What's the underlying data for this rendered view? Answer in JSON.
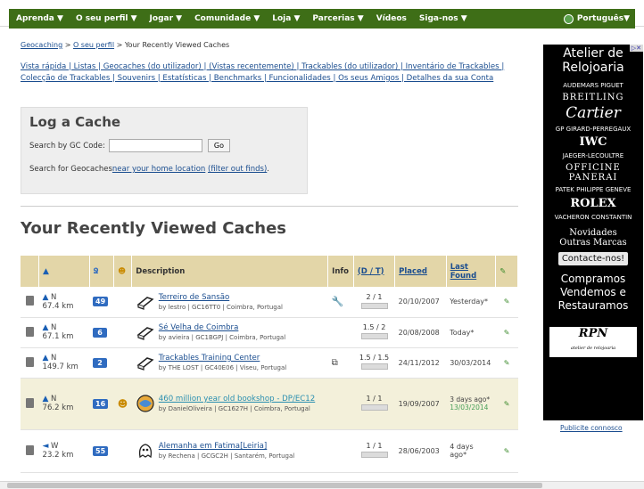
{
  "topnav": {
    "items": [
      "Aprenda ▼",
      "O seu perfil ▼",
      "Jogar ▼",
      "Comunidade ▼",
      "Loja ▼",
      "Parcerias ▼",
      "Vídeos",
      "Siga-nos ▼"
    ],
    "language": "Português▼"
  },
  "breadcrumb": {
    "link1": "Geocaching",
    "sep1": " > ",
    "link2": "O seu perfil",
    "rest": " > Your Recently Viewed Caches"
  },
  "sublinks": {
    "text": "Vista rápida | Listas | Geocaches (do utilizador) | (Vistas recentemente) | Trackables (do utilizador) | Inventário de Trackables | Colecção de Trackables | Souvenirs | Estatísticas | Benchmarks | Funcionalidades | Os seus Amigos | Detalhes da sua Conta"
  },
  "log_cache": {
    "title": "Log a Cache",
    "gc_label": "Search by GC Code:",
    "gc_value": "",
    "go_label": "Go",
    "search_prefix": "Search for Geocaches",
    "near_link": "near your home location",
    "filter_link": "(filter out finds)",
    "suffix": "."
  },
  "page_title": "Your Recently Viewed Caches",
  "table": {
    "headers": {
      "description": "Description",
      "info": "Info",
      "dt": "(D / T)",
      "placed": "Placed",
      "last_found": "Last Found"
    },
    "rows": [
      {
        "dir": "N",
        "dist": "67.4 km",
        "fav": "49",
        "smile": "",
        "title": "Terreiro de Sansão",
        "sub": "by lestro | GC16TT0 | Coimbra, Portugal",
        "dt": "2 / 1",
        "placed": "20/10/2007",
        "last": "Yesterday*",
        "last2": ""
      },
      {
        "dir": "N",
        "dist": "67.1 km",
        "fav": "6",
        "smile": "",
        "title": "Sé Velha de Coimbra",
        "sub": "by avieira | GC1BGPJ | Coimbra, Portugal",
        "dt": "1.5 / 2",
        "placed": "20/08/2008",
        "last": "Today*",
        "last2": ""
      },
      {
        "dir": "N",
        "dist": "149.7 km",
        "fav": "2",
        "smile": "",
        "title": "Trackables Training Center",
        "sub": "by THE LOST | GC40E06 | Viseu, Portugal",
        "dt": "1.5 / 1.5",
        "placed": "24/11/2012",
        "last": "30/03/2014",
        "last2": ""
      },
      {
        "dir": "N",
        "dist": "76.2 km",
        "fav": "16",
        "smile": "☻",
        "title": "460 million year old bookshop - DP/EC12",
        "sub": "by DanielOliveira | GC1627H | Coimbra, Portugal",
        "dt": "1 / 1",
        "placed": "19/09/2007",
        "last": "3 days ago*",
        "last2": "13/03/2014"
      },
      {
        "dir": "W",
        "dist": "23.2 km",
        "fav": "55",
        "smile": "",
        "title": "Alemanha em Fatima[Leiria]",
        "sub": "by Rechena | GCGC2H | Santarém, Portugal",
        "dt": "1 / 1",
        "placed": "28/06/2003",
        "last": "4 days ago*",
        "last2": ""
      }
    ]
  },
  "ad": {
    "headline1": "Atelier de",
    "headline2": "Relojoaria",
    "brands": [
      "AUDEMARS PIGUET",
      "BREITLING",
      "Cartier",
      "GP GIRARD-PERREGAUX",
      "IWC",
      "JAEGER-LECOULTRE",
      "OFFICINE PANERAI",
      "PATEK PHILIPPE GENEVE",
      "ROLEX",
      "VACHERON CONSTANTIN"
    ],
    "novidades": "Novidades",
    "outras": "Outras Marcas",
    "contact": "Contacte-nos!",
    "compramos": "Compramos",
    "vendemos": "Vendemos e",
    "restauramos": "Restauramos",
    "rpn": "RPN",
    "rpn_sub": "atelier de relojoaria",
    "publicite": "Publicite connosco"
  }
}
